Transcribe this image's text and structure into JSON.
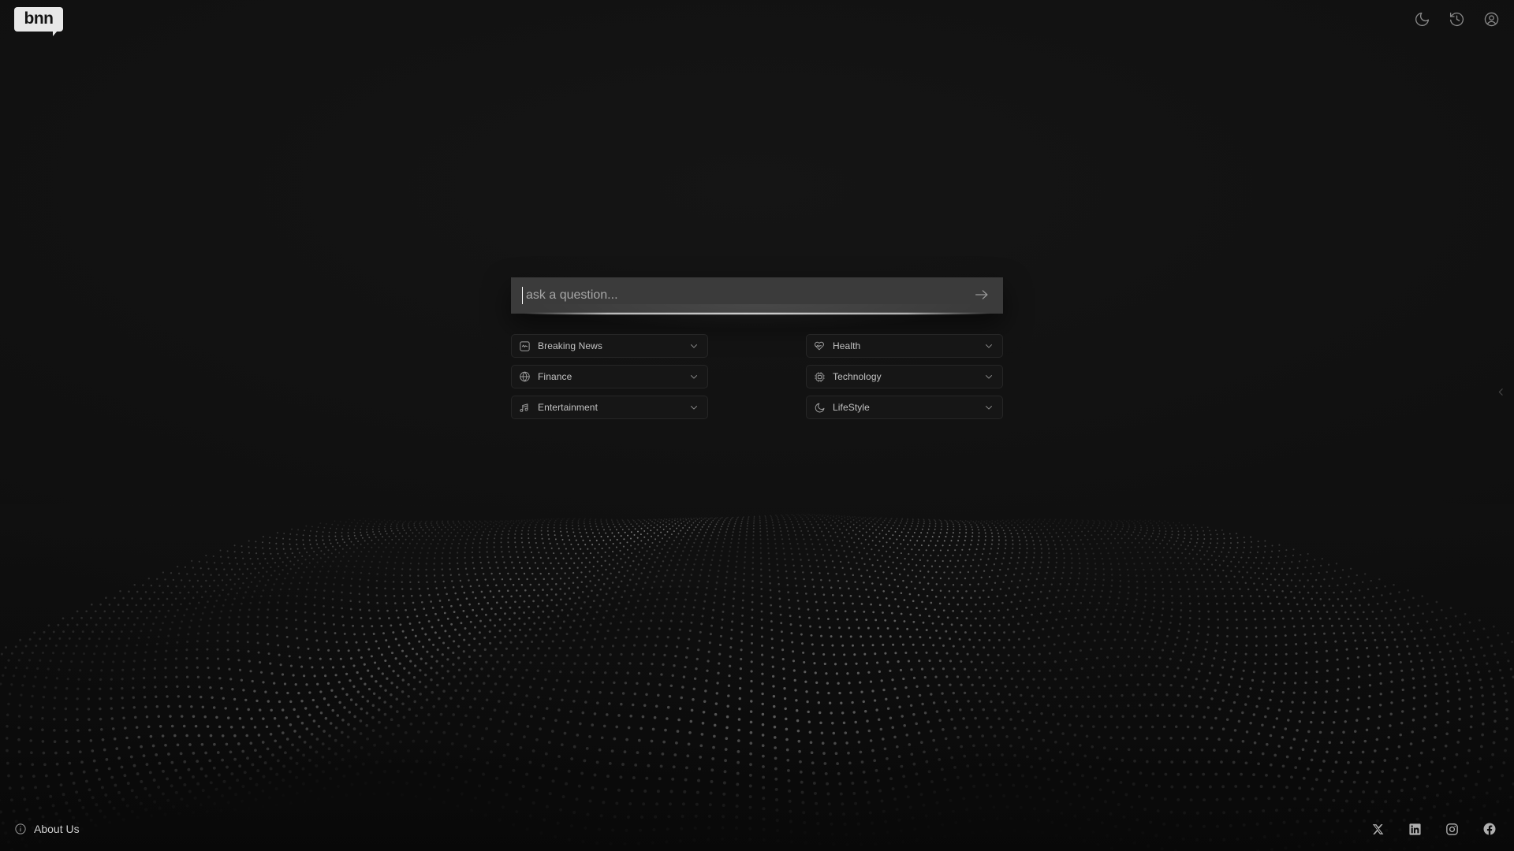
{
  "app": {
    "logo_text": "bnn",
    "background_color": "#111111",
    "accent_color": "#ffffff"
  },
  "header": {
    "actions": [
      {
        "name": "theme-toggle",
        "icon": "moon-icon",
        "label": "Dark mode"
      },
      {
        "name": "history",
        "icon": "history-icon",
        "label": "History"
      },
      {
        "name": "account",
        "icon": "user-circle-icon",
        "label": "Account"
      }
    ]
  },
  "search": {
    "placeholder": "ask a question...",
    "value": "",
    "submit_icon": "arrow-right-icon",
    "submit_label": "Submit"
  },
  "categories": {
    "items": [
      {
        "label": "Breaking News",
        "icon": "activity-square-icon",
        "chevron": "chevron-down-icon"
      },
      {
        "label": "Health",
        "icon": "heart-pulse-icon",
        "chevron": "chevron-down-icon"
      },
      {
        "label": "Finance",
        "icon": "globe-icon",
        "chevron": "chevron-down-icon"
      },
      {
        "label": "Technology",
        "icon": "cpu-chip-icon",
        "chevron": "chevron-down-icon"
      },
      {
        "label": "Entertainment",
        "icon": "music-notes-icon",
        "chevron": "chevron-down-icon"
      },
      {
        "label": "LifeStyle",
        "icon": "moon-icon",
        "chevron": "chevron-down-icon"
      }
    ]
  },
  "panel_toggle": {
    "icon": "chevron-left-icon",
    "label": "Open side panel"
  },
  "footer": {
    "about_label": "About Us",
    "about_icon": "info-circle-icon",
    "socials": [
      {
        "name": "x-twitter",
        "icon": "x-icon",
        "label": "X"
      },
      {
        "name": "linkedin",
        "icon": "linkedin-icon",
        "label": "LinkedIn"
      },
      {
        "name": "instagram",
        "icon": "instagram-icon",
        "label": "Instagram"
      },
      {
        "name": "facebook",
        "icon": "facebook-icon",
        "label": "Facebook"
      }
    ]
  }
}
